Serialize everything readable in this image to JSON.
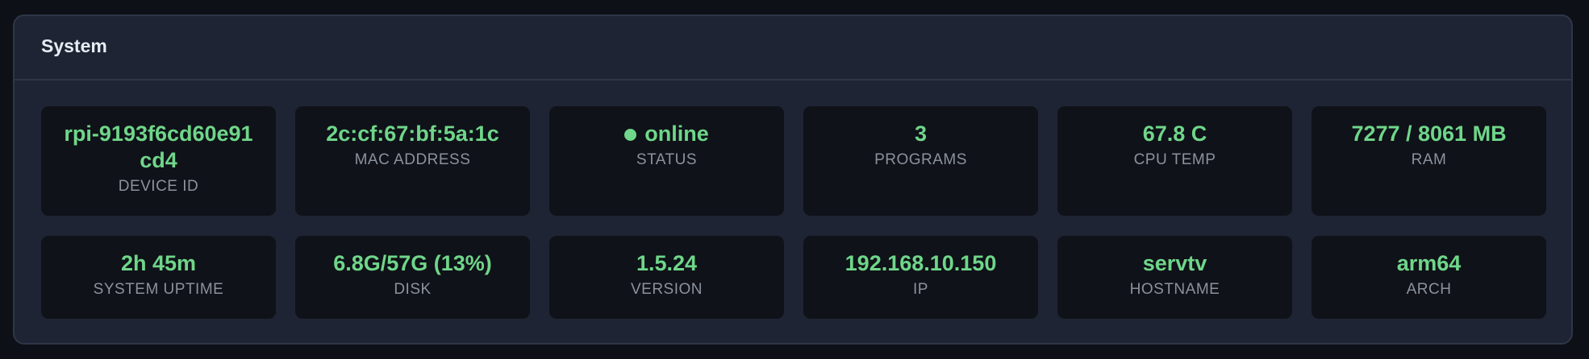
{
  "panel": {
    "title": "System"
  },
  "cards": [
    {
      "value": "rpi-9193f6cd60e91cd4",
      "label": "DEVICE ID"
    },
    {
      "value": "2c:cf:67:bf:5a:1c",
      "label": "MAC ADDRESS"
    },
    {
      "value": "online",
      "label": "STATUS",
      "status_color": "#6fd68a"
    },
    {
      "value": "3",
      "label": "PROGRAMS"
    },
    {
      "value": "67.8 C",
      "label": "CPU TEMP"
    },
    {
      "value": "7277 / 8061 MB",
      "label": "RAM"
    },
    {
      "value": "2h 45m",
      "label": "SYSTEM UPTIME"
    },
    {
      "value": "6.8G/57G (13%)",
      "label": "DISK"
    },
    {
      "value": "1.5.24",
      "label": "VERSION"
    },
    {
      "value": "192.168.10.150",
      "label": "IP"
    },
    {
      "value": "servtv",
      "label": "HOSTNAME"
    },
    {
      "value": "arm64",
      "label": "ARCH"
    }
  ],
  "colors": {
    "background": "#0d1117",
    "panel": "#1e2433",
    "card": "#0f1218",
    "value": "#6fd68a",
    "label": "#8b929c"
  }
}
